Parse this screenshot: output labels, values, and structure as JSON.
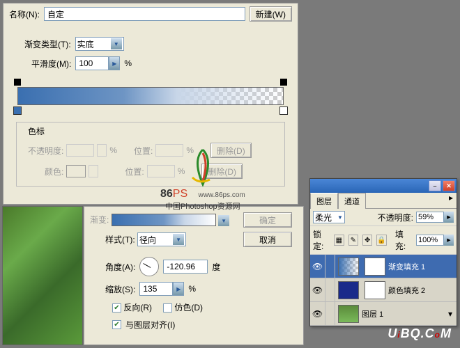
{
  "gradient_editor": {
    "name_label": "名称(N):",
    "name_value": "自定",
    "new_btn": "新建(W)",
    "type_label": "渐变类型(T):",
    "type_value": "实底",
    "smoothness_label": "平滑度(M):",
    "smoothness_value": "100",
    "percent": "%",
    "stops": {
      "legend": "色标",
      "opacity_label": "不透明度:",
      "position_label": "位置:",
      "delete_btn": "删除(D)",
      "color_label": "颜色:"
    }
  },
  "style_panel": {
    "gradient_label": "渐变:",
    "confirm_btn": "确定",
    "cancel_btn": "取消",
    "style_label": "样式(T):",
    "style_value": "径向",
    "angle_label": "角度(A):",
    "angle_value": "-120.96",
    "degree": "度",
    "scale_label": "缩放(S):",
    "scale_value": "135",
    "percent": "%",
    "reverse_label": "反向(R)",
    "reverse_checked": true,
    "dither_label": "仿色(D)",
    "dither_checked": false,
    "align_label": "与图层对齐(I)",
    "align_checked": true
  },
  "layers_panel": {
    "tabs": [
      "图层",
      "通道"
    ],
    "blend_mode": "柔光",
    "opacity_label": "不透明度:",
    "opacity_value": "59%",
    "lock_label": "锁定:",
    "fill_label": "填充:",
    "fill_value": "100%",
    "layers": [
      {
        "name": "渐变填充 1",
        "selected": true,
        "thumb": "grad",
        "mask": true
      },
      {
        "name": "颜色填充 2",
        "selected": false,
        "thumb": "solid",
        "mask": true
      },
      {
        "name": "图层 1",
        "selected": false,
        "thumb": "img",
        "mask": false
      }
    ]
  },
  "watermark": {
    "brand": "86",
    "brand_suffix": "PS",
    "url": "www.86ps.com",
    "subtitle": "中国Photoshop资源网"
  },
  "footer": "UiBQ.CoM"
}
